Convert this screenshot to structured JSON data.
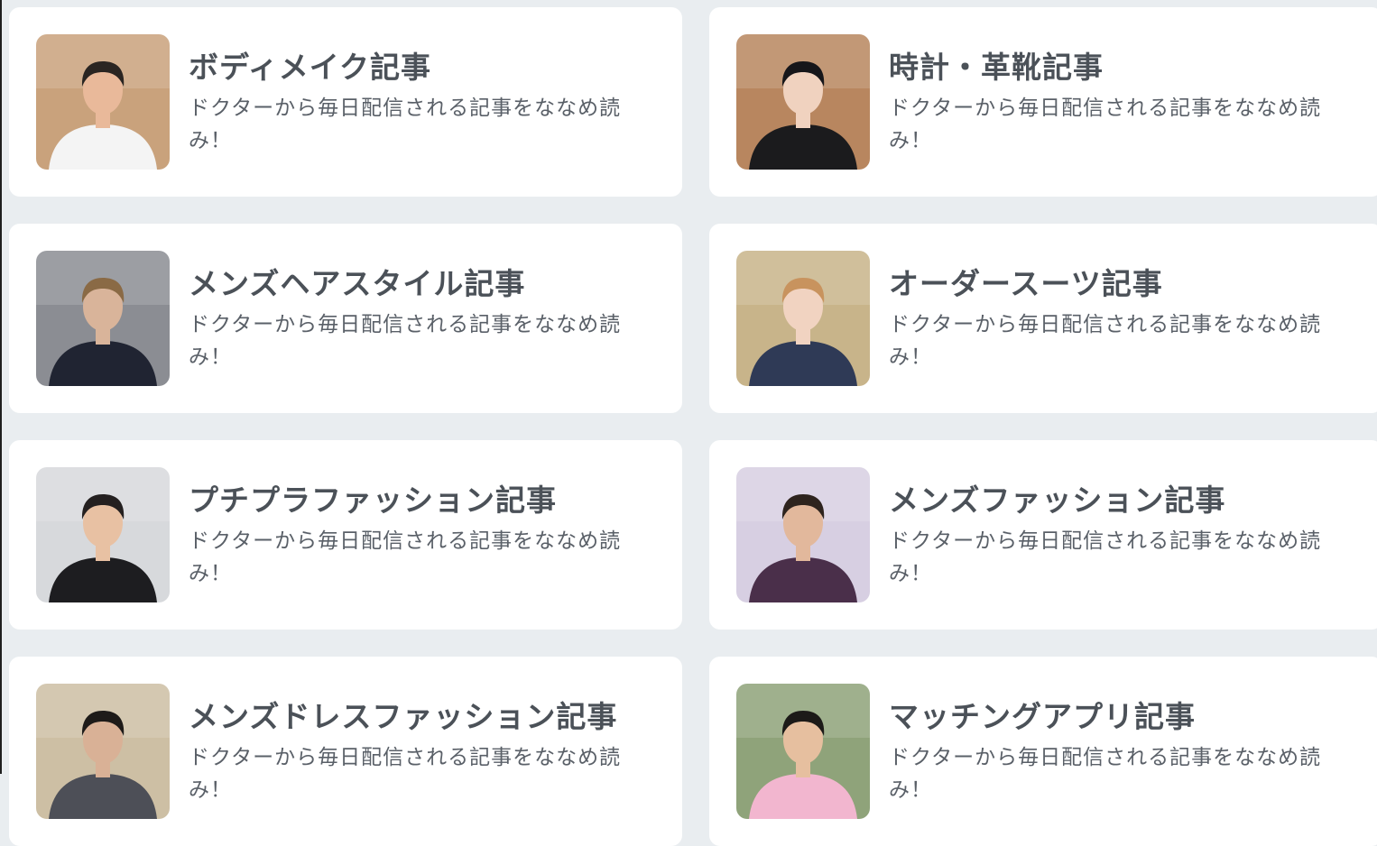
{
  "cards": [
    {
      "title": "ボディメイク記事",
      "description": "ドクターから毎日配信される記事をななめ読み！",
      "photo": "avatar-bodymake",
      "bg": "#c9a27c",
      "skin": "#e9b99a",
      "shirt": "#f4f4f4",
      "hair": "#2a2522"
    },
    {
      "title": "時計・革靴記事",
      "description": "ドクターから毎日配信される記事をななめ読み！",
      "photo": "avatar-watch-shoes",
      "bg": "#b8865f",
      "skin": "#f0d2bf",
      "shirt": "#1b1b1d",
      "hair": "#16161a"
    },
    {
      "title": "メンズヘアスタイル記事",
      "description": "ドクターから毎日配信される記事をななめ読み！",
      "photo": "avatar-hairstyle",
      "bg": "#8b8d93",
      "skin": "#d9b49a",
      "shirt": "#202432",
      "hair": "#8a6a45"
    },
    {
      "title": "オーダースーツ記事",
      "description": "ドクターから毎日配信される記事をななめ読み！",
      "photo": "avatar-order-suit",
      "bg": "#c8b48a",
      "skin": "#f1d3c1",
      "shirt": "#2f3a56",
      "hair": "#c8935e"
    },
    {
      "title": "プチプラファッション記事",
      "description": "ドクターから毎日配信される記事をななめ読み！",
      "photo": "avatar-petit-fashion",
      "bg": "#d7d9dc",
      "skin": "#e8c1a3",
      "shirt": "#1d1d20",
      "hair": "#242020"
    },
    {
      "title": "メンズファッション記事",
      "description": "ドクターから毎日配信される記事をななめ読み！",
      "photo": "avatar-mens-fashion",
      "bg": "#d7cfe2",
      "skin": "#e2b89c",
      "shirt": "#4a2f4a",
      "hair": "#2e241e"
    },
    {
      "title": "メンズドレスファッション記事",
      "description": "ドクターから毎日配信される記事をななめ読み！",
      "photo": "avatar-dress-fashion",
      "bg": "#cdbfa4",
      "skin": "#d9b196",
      "shirt": "#4d4f57",
      "hair": "#1e1b19"
    },
    {
      "title": "マッチングアプリ記事",
      "description": "ドクターから毎日配信される記事をななめ読み！",
      "photo": "avatar-matching-app",
      "bg": "#8fa37a",
      "skin": "#e6bf9f",
      "shirt": "#f2b6cf",
      "hair": "#1c1a18"
    }
  ]
}
